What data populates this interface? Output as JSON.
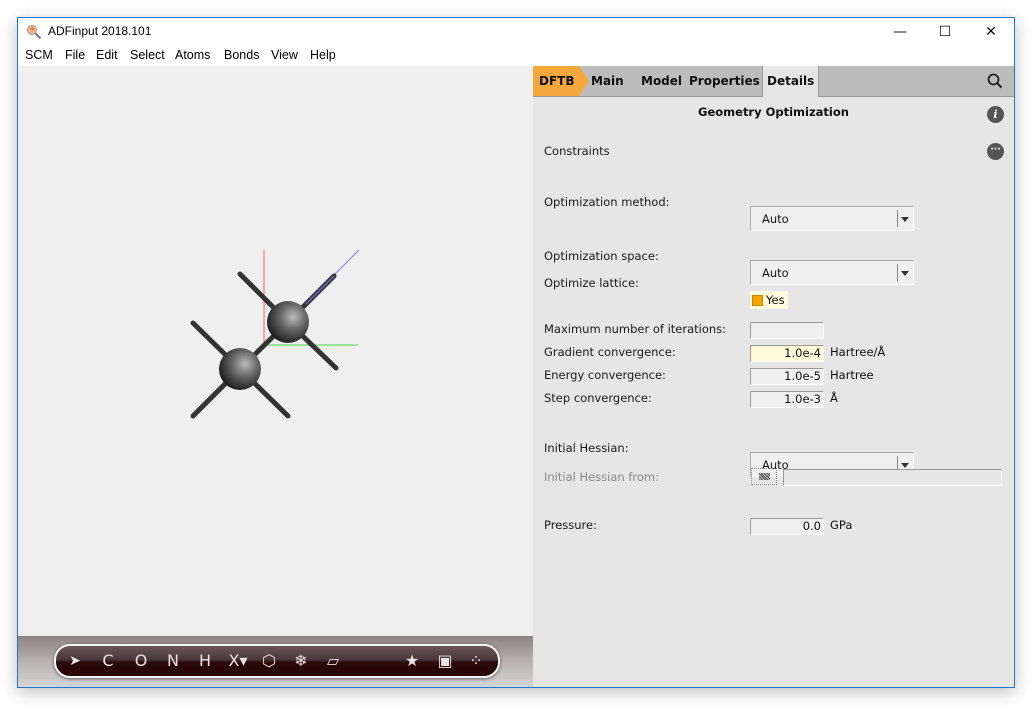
{
  "window": {
    "title": "ADFinput 2018.101",
    "controls": {
      "minimize": "—",
      "maximize": "☐",
      "close": "✕"
    }
  },
  "menubar": {
    "items": [
      "SCM",
      "File",
      "Edit",
      "Select",
      "Atoms",
      "Bonds",
      "View",
      "Help"
    ]
  },
  "viewport": {
    "molecule": "ethane-like structure with two carbon atoms and six bonds",
    "axes_colors": {
      "x": "#ff4444",
      "y": "#33dd33",
      "z": "#6666ff"
    },
    "toolbar": {
      "items": [
        {
          "name": "select-arrow-icon",
          "glyph": "➤"
        },
        {
          "name": "carbon",
          "glyph": "C"
        },
        {
          "name": "oxygen",
          "glyph": "O"
        },
        {
          "name": "nitrogen",
          "glyph": "N"
        },
        {
          "name": "hydrogen",
          "glyph": "H"
        },
        {
          "name": "other-element",
          "glyph": "X▾"
        },
        {
          "name": "ring-icon",
          "glyph": "⬡"
        },
        {
          "name": "snowflake-icon",
          "glyph": "❄"
        },
        {
          "name": "plane-icon",
          "glyph": "▱"
        },
        {
          "name": "star-icon",
          "glyph": "★"
        },
        {
          "name": "crystal-icon",
          "glyph": "▣"
        },
        {
          "name": "molecules-icon",
          "glyph": "⁘"
        }
      ]
    }
  },
  "panel": {
    "tabs": [
      {
        "label": "DFTB",
        "active_engine": true
      },
      {
        "label": "Main"
      },
      {
        "label": "Model"
      },
      {
        "label": "Properties"
      },
      {
        "label": "Details",
        "selected": true
      }
    ],
    "search_icon": "search-icon",
    "section_title": "Geometry Optimization",
    "info_icon": "i",
    "constraints_label": "Constraints",
    "more_icon": "···",
    "fields": {
      "optimization_method": {
        "label": "Optimization method:",
        "value": "Auto"
      },
      "optimization_space": {
        "label": "Optimization space:",
        "value": "Auto"
      },
      "optimize_lattice": {
        "label": "Optimize lattice:",
        "value": "Yes",
        "checked": true
      },
      "max_iterations": {
        "label": "Maximum number of iterations:",
        "value": ""
      },
      "gradient_convergence": {
        "label": "Gradient convergence:",
        "value": "1.0e-4",
        "unit": "Hartree/Å"
      },
      "energy_convergence": {
        "label": "Energy convergence:",
        "value": "1.0e-5",
        "unit": "Hartree"
      },
      "step_convergence": {
        "label": "Step convergence:",
        "value": "1.0e-3",
        "unit": "Å"
      },
      "initial_hessian": {
        "label": "Initial Hessian:",
        "value": "Auto"
      },
      "initial_hessian_from": {
        "label": "Initial Hessian from:",
        "value": "",
        "disabled": true
      },
      "pressure": {
        "label": "Pressure:",
        "value": "0.0",
        "unit": "GPa"
      }
    }
  }
}
